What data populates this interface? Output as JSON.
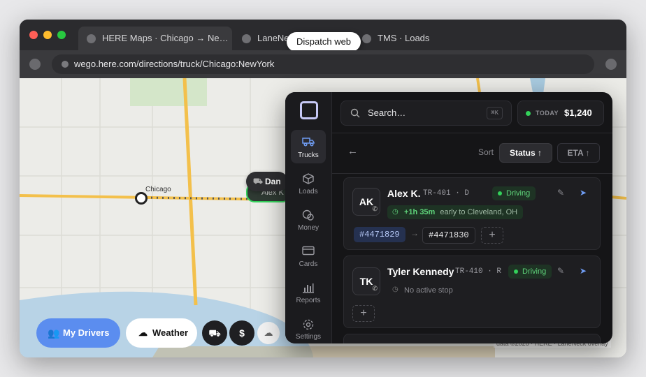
{
  "browser": {
    "tabs": [
      {
        "label": "HERE Maps · Chicago → Ne…"
      },
      {
        "label": "LaneNe"
      },
      {
        "label": "TMS · Loads"
      }
    ],
    "tooltip": "Dispatch web",
    "url": "wego.here.com/directions/truck/Chicago:NewYork"
  },
  "map": {
    "city_label": "Chicago",
    "driver_chip": "Dan W",
    "driver_chip_partial": "Alex K",
    "attribution": "data ©2026 · HERE · LaneNeck overlay"
  },
  "bottom_bar": {
    "my_drivers": "My Drivers",
    "weather": "Weather"
  },
  "sidebar": {
    "items": [
      {
        "label": "Trucks",
        "icon": "truck-icon"
      },
      {
        "label": "Loads",
        "icon": "box-icon"
      },
      {
        "label": "Money",
        "icon": "coins-icon"
      },
      {
        "label": "Cards",
        "icon": "card-icon"
      },
      {
        "label": "Reports",
        "icon": "bar-chart-icon"
      },
      {
        "label": "Settings",
        "icon": "gear-icon"
      }
    ]
  },
  "header": {
    "search_placeholder": "Search…",
    "shortcut": "⌘K",
    "today_label": "TODAY",
    "today_amount": "$1,240"
  },
  "sort": {
    "label": "Sort",
    "status": "Status ↑",
    "eta": "ETA ↑"
  },
  "drivers": [
    {
      "initials": "AK",
      "name": "Alex K.",
      "meta": "TR-401 · D",
      "status": "Driving",
      "eta_delta": "+1h 35m",
      "eta_text": "early to Cleveland, OH",
      "load_current": "#4471829",
      "load_next": "#4471830"
    },
    {
      "initials": "TK",
      "name": "Tyler Kennedy",
      "meta": "TR-410 · R",
      "status": "Driving",
      "no_stop": "No active stop"
    }
  ],
  "colors": {
    "accent_blue": "#5b8def",
    "driving_green": "#33d15a",
    "my_drivers_bg": "#5b8def"
  }
}
